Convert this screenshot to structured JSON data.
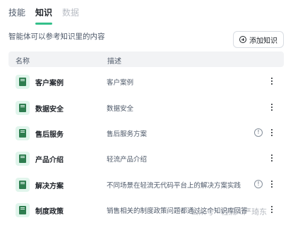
{
  "tabs": [
    {
      "label": "技能",
      "state": "normal"
    },
    {
      "label": "知识",
      "state": "active"
    },
    {
      "label": "数据",
      "state": "disabled"
    }
  ],
  "subtitle": "智能体可以参考知识里的内容",
  "add_button": {
    "label": "添加知识",
    "icon": "plus-circle-icon"
  },
  "table": {
    "headers": {
      "name": "名称",
      "desc": "描述"
    },
    "rows": [
      {
        "name": "客户案例",
        "desc": "客户案例",
        "warning": false
      },
      {
        "name": "数据安全",
        "desc": "数据安全",
        "warning": false
      },
      {
        "name": "售后服务",
        "desc": "售后服务方案",
        "warning": true
      },
      {
        "name": "产品介绍",
        "desc": "轻流产品介绍",
        "warning": false
      },
      {
        "name": "解决方案",
        "desc": "不同场景在轻流无代码平台上的解决方案实践",
        "warning": true
      },
      {
        "name": "制度政策",
        "desc": "销售相关的制度政策问题都通过这个知识库回答",
        "warning": false
      }
    ]
  },
  "watermark": "公众号 · 轻流AI严琦东",
  "colors": {
    "accent": "#34c08a",
    "book_icon": "#2e7d4f",
    "book_bg": "#e1f5ec"
  }
}
